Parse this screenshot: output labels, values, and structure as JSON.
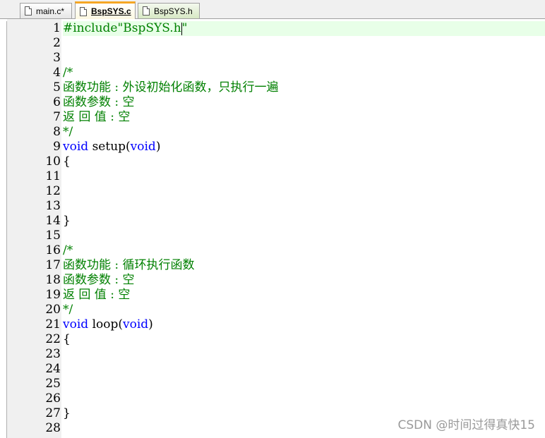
{
  "tabs": [
    {
      "label": "main.c*",
      "active": false
    },
    {
      "label": "BspSYS.c",
      "active": true
    },
    {
      "label": "BspSYS.h",
      "active": false
    }
  ],
  "editor": {
    "current_line": 1,
    "lines": [
      {
        "n": "1",
        "tokens": [
          {
            "t": "#include\"BspSYS.h\"",
            "c": "preproc"
          }
        ]
      },
      {
        "n": "2",
        "tokens": []
      },
      {
        "n": "3",
        "tokens": []
      },
      {
        "n": "4",
        "tokens": [
          {
            "t": "/*",
            "c": "comment"
          }
        ]
      },
      {
        "n": "5",
        "tokens": [
          {
            "t": "函数功能 : 外设初始化函数，只执行一遍",
            "c": "comment"
          }
        ]
      },
      {
        "n": "6",
        "tokens": [
          {
            "t": "函数参数 : 空",
            "c": "comment"
          }
        ]
      },
      {
        "n": "7",
        "tokens": [
          {
            "t": "返 回 值 : 空",
            "c": "comment"
          }
        ]
      },
      {
        "n": "8",
        "tokens": [
          {
            "t": "*/",
            "c": "comment"
          }
        ]
      },
      {
        "n": "9",
        "tokens": [
          {
            "t": "void",
            "c": "kw"
          },
          {
            "t": " setup(",
            "c": "plain"
          },
          {
            "t": "void",
            "c": "kw"
          },
          {
            "t": ")",
            "c": "plain"
          }
        ]
      },
      {
        "n": "10",
        "tokens": [
          {
            "t": "{",
            "c": "plain"
          }
        ]
      },
      {
        "n": "11",
        "tokens": []
      },
      {
        "n": "12",
        "tokens": []
      },
      {
        "n": "13",
        "tokens": []
      },
      {
        "n": "14",
        "tokens": [
          {
            "t": "}",
            "c": "plain"
          }
        ]
      },
      {
        "n": "15",
        "tokens": []
      },
      {
        "n": "16",
        "tokens": [
          {
            "t": "/*",
            "c": "comment"
          }
        ]
      },
      {
        "n": "17",
        "tokens": [
          {
            "t": "函数功能 : 循环执行函数",
            "c": "comment"
          }
        ]
      },
      {
        "n": "18",
        "tokens": [
          {
            "t": "函数参数 : 空",
            "c": "comment"
          }
        ]
      },
      {
        "n": "19",
        "tokens": [
          {
            "t": "返 回 值 : 空",
            "c": "comment"
          }
        ]
      },
      {
        "n": "20",
        "tokens": [
          {
            "t": "*/",
            "c": "comment"
          }
        ]
      },
      {
        "n": "21",
        "tokens": [
          {
            "t": "void",
            "c": "kw"
          },
          {
            "t": " loop(",
            "c": "plain"
          },
          {
            "t": "void",
            "c": "kw"
          },
          {
            "t": ")",
            "c": "plain"
          }
        ]
      },
      {
        "n": "22",
        "tokens": [
          {
            "t": "{",
            "c": "plain"
          }
        ]
      },
      {
        "n": "23",
        "tokens": []
      },
      {
        "n": "24",
        "tokens": []
      },
      {
        "n": "25",
        "tokens": []
      },
      {
        "n": "26",
        "tokens": []
      },
      {
        "n": "27",
        "tokens": [
          {
            "t": "}",
            "c": "plain"
          }
        ]
      },
      {
        "n": "28",
        "tokens": []
      }
    ]
  },
  "watermark": "CSDN @时间过得真快15",
  "colors": {
    "comment": "#008000",
    "keyword": "#0000ff",
    "current_line_bg": "#e8ffe8",
    "active_tab_accent": "#f5a623"
  }
}
